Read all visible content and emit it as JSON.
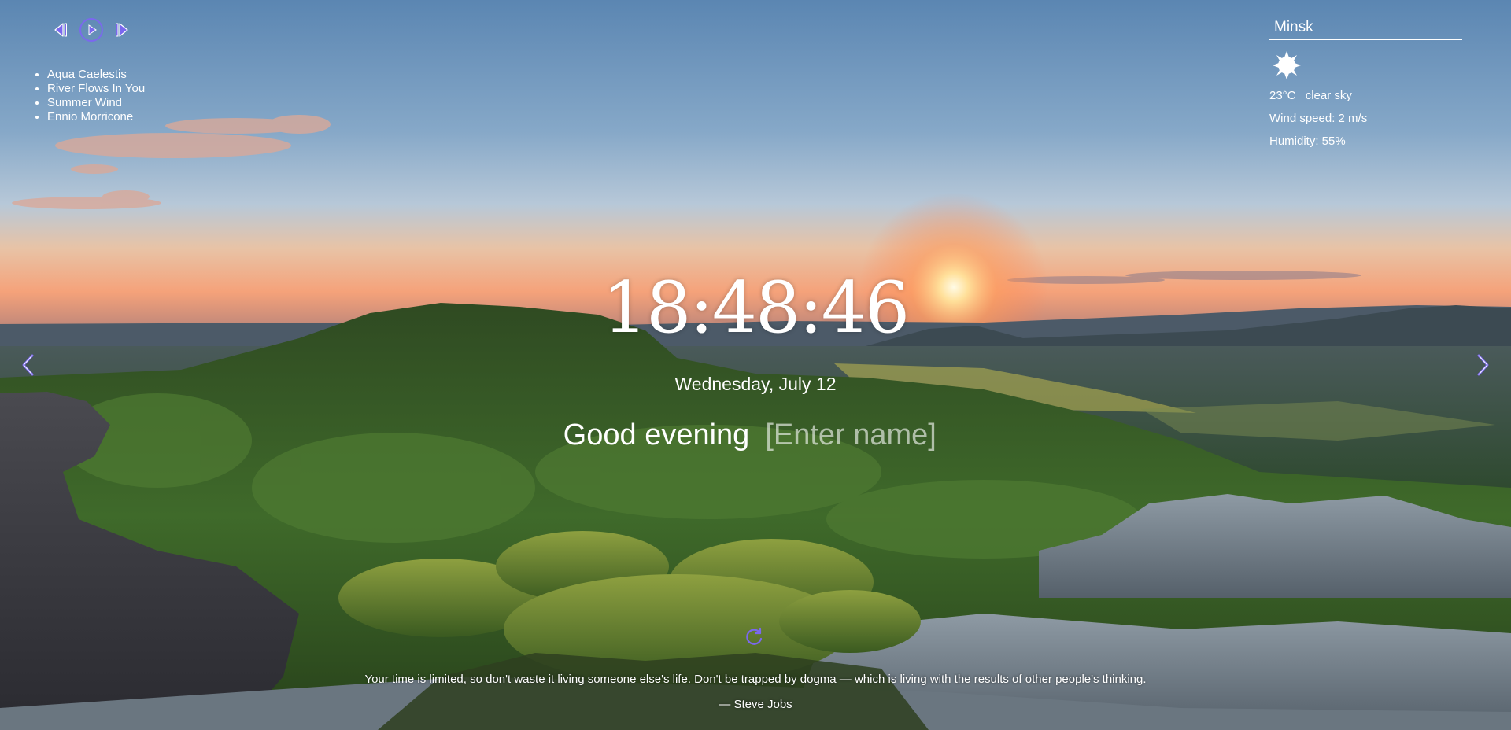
{
  "player": {
    "icons": [
      "play-prev-icon",
      "play-icon",
      "play-next-icon"
    ],
    "accent_color": "#7b68ee",
    "playlist": [
      {
        "title": "Aqua Caelestis"
      },
      {
        "title": "River Flows In You"
      },
      {
        "title": "Summer Wind"
      },
      {
        "title": "Ennio Morricone"
      }
    ]
  },
  "weather": {
    "city": "Minsk",
    "icon": "sun-icon",
    "temperature": "23°C",
    "description": "clear sky",
    "wind": "Wind speed: 2 m/s",
    "humidity": "Humidity: 55%"
  },
  "clock": {
    "time": "18:48:46",
    "date": "Wednesday, July 12"
  },
  "greeting": {
    "text": "Good evening",
    "name_placeholder": "[Enter name]"
  },
  "slider": {
    "prev_icon": "chevron-left-icon",
    "next_icon": "chevron-right-icon"
  },
  "quote": {
    "text": "Your time is limited, so don't waste it living someone else's life. Don't be trapped by dogma — which is living with the results of other people's thinking.",
    "author": "— Steve Jobs",
    "refresh_icon": "refresh-icon"
  }
}
